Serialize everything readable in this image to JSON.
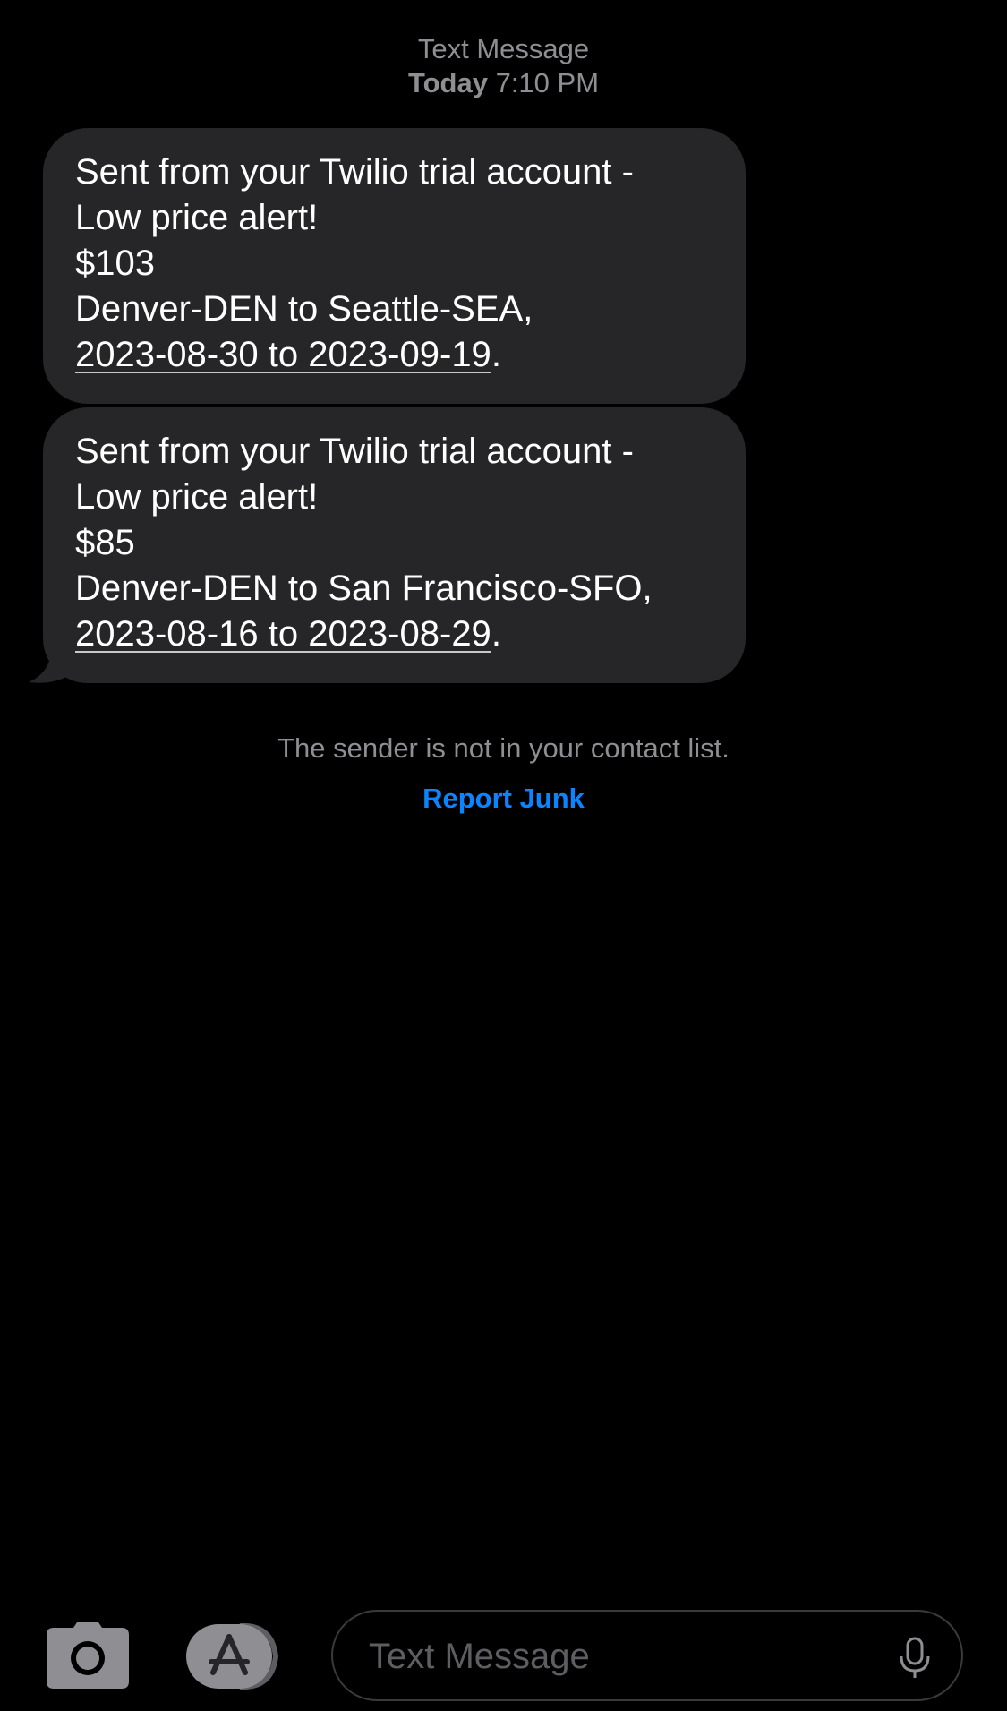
{
  "header": {
    "service": "Text Message",
    "day": "Today",
    "time": "7:10 PM"
  },
  "messages": [
    {
      "line1": "Sent from your Twilio trial account -",
      "line2": "Low price alert!",
      "price": "$103",
      "route": "Denver-DEN to Seattle-SEA,",
      "dates": "2023-08-30 to 2023-09-19",
      "end": "."
    },
    {
      "line1": "Sent from your Twilio trial account -",
      "line2": "Low price alert!",
      "price": "$85",
      "route": "Denver-DEN to San Francisco-SFO,",
      "dates": "2023-08-16 to 2023-08-29",
      "end": "."
    }
  ],
  "notice": {
    "text": "The sender is not in your contact list.",
    "report_label": "Report Junk"
  },
  "composer": {
    "placeholder": "Text Message"
  },
  "icons": {
    "camera": "camera-icon",
    "apps": "app-store-icon",
    "mic": "microphone-icon"
  },
  "colors": {
    "background": "#000000",
    "bubble": "#262628",
    "secondary_text": "#8e8e93",
    "link": "#0a84ff"
  }
}
